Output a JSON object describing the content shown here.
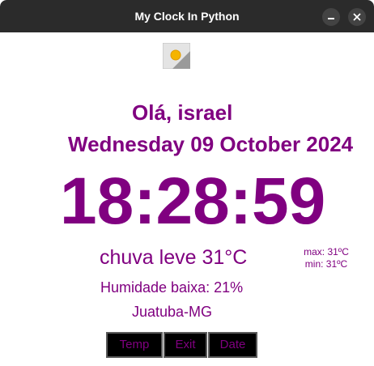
{
  "window": {
    "title": "My Clock In Python"
  },
  "greeting": "Olá, israel",
  "date": "Wednesday 09 October 2024",
  "time": "18:28:59",
  "weather": {
    "description": "chuva leve 31°C",
    "max": "max: 31ºC",
    "min": "min: 31ºC",
    "icon": "sun-icon"
  },
  "humidity": "Humidade baixa: 21%",
  "location": "Juatuba-MG",
  "buttons": {
    "temp": "Temp",
    "exit": "Exit",
    "date": "Date"
  },
  "colors": {
    "text": "#800080",
    "titlebar": "#2b2b2b",
    "button_bg": "#000000"
  }
}
